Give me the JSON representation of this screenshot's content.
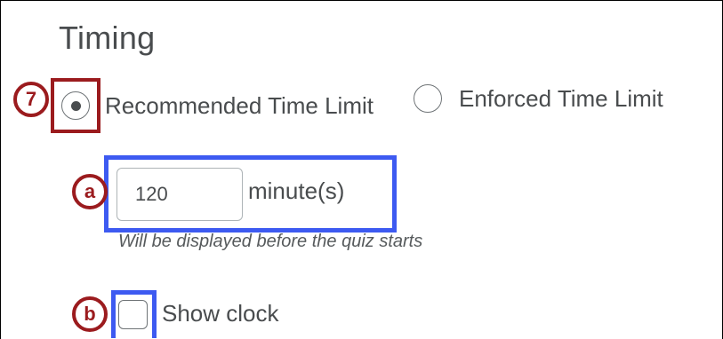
{
  "section": {
    "title": "Timing"
  },
  "callouts": {
    "step7": "7",
    "stepA": "a",
    "stepB": "b"
  },
  "time_limit": {
    "recommended_label": "Recommended Time Limit",
    "recommended_selected": true,
    "enforced_label": "Enforced Time Limit",
    "enforced_selected": false,
    "minutes_value": "120",
    "unit_label": "minute(s)",
    "helper_text": "Will be displayed before the quiz starts"
  },
  "clock": {
    "label": "Show clock",
    "checked": false
  },
  "colors": {
    "callout_red": "#9b1b1e",
    "highlight_blue": "#3d5af1",
    "text": "#494c4e"
  }
}
